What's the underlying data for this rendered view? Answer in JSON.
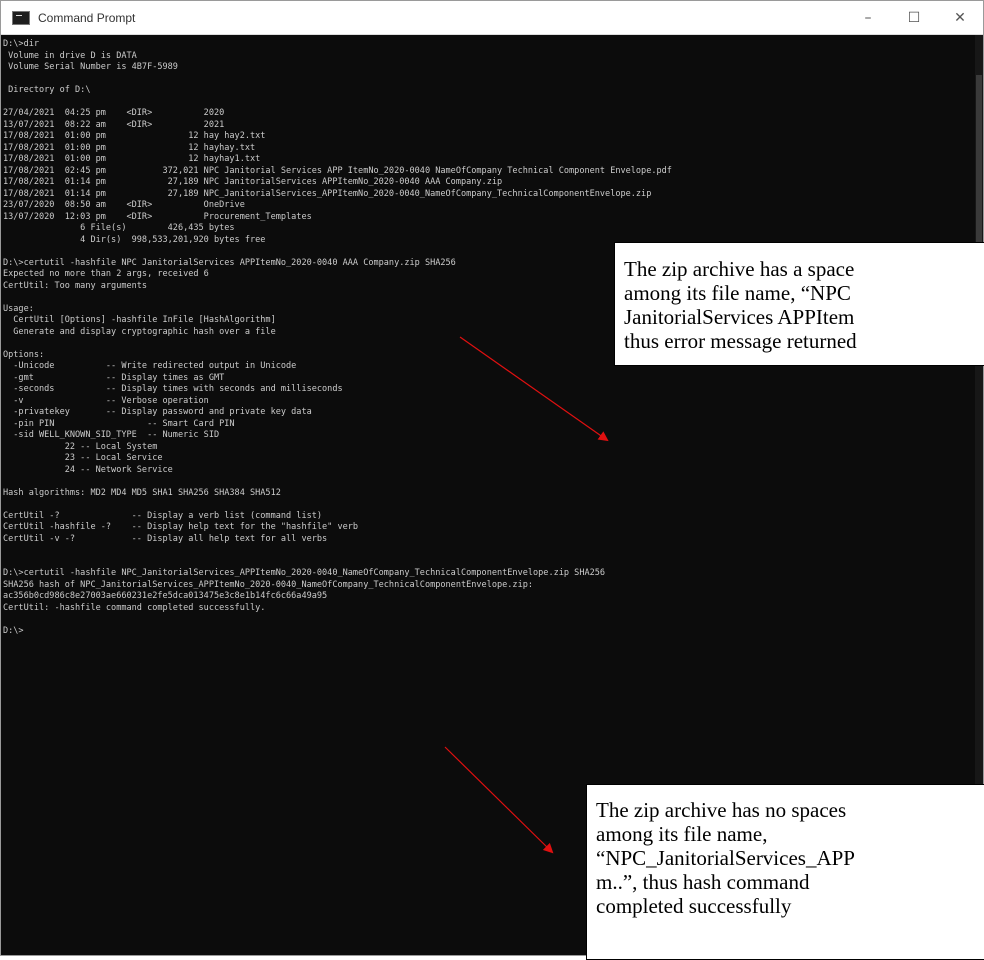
{
  "window": {
    "title": "Command Prompt",
    "controls": {
      "minimize": "–",
      "maximize": "☐",
      "close": "✕"
    }
  },
  "console_lines": [
    "D:\\>dir",
    " Volume in drive D is DATA",
    " Volume Serial Number is 4B7F-5989",
    "",
    " Directory of D:\\",
    "",
    "27/04/2021  04:25 pm    <DIR>          2020",
    "13/07/2021  08:22 am    <DIR>          2021",
    "17/08/2021  01:00 pm                12 hay hay2.txt",
    "17/08/2021  01:00 pm                12 hayhay.txt",
    "17/08/2021  01:00 pm                12 hayhay1.txt",
    "17/08/2021  02:45 pm           372,021 NPC Janitorial Services APP ItemNo_2020-0040 NameOfCompany Technical Component Envelope.pdf",
    "17/08/2021  01:14 pm            27,189 NPC JanitorialServices APPItemNo_2020-0040 AAA Company.zip",
    "17/08/2021  01:14 pm            27,189 NPC_JanitorialServices_APPItemNo_2020-0040_NameOfCompany_TechnicalComponentEnvelope.zip",
    "23/07/2020  08:50 am    <DIR>          OneDrive",
    "13/07/2020  12:03 pm    <DIR>          Procurement_Templates",
    "               6 File(s)        426,435 bytes",
    "               4 Dir(s)  998,533,201,920 bytes free",
    "",
    "D:\\>certutil -hashfile NPC JanitorialServices APPItemNo_2020-0040 AAA Company.zip SHA256",
    "Expected no more than 2 args, received 6",
    "CertUtil: Too many arguments",
    "",
    "Usage:",
    "  CertUtil [Options] -hashfile InFile [HashAlgorithm]",
    "  Generate and display cryptographic hash over a file",
    "",
    "Options:",
    "  -Unicode          -- Write redirected output in Unicode",
    "  -gmt              -- Display times as GMT",
    "  -seconds          -- Display times with seconds and milliseconds",
    "  -v                -- Verbose operation",
    "  -privatekey       -- Display password and private key data",
    "  -pin PIN                  -- Smart Card PIN",
    "  -sid WELL_KNOWN_SID_TYPE  -- Numeric SID",
    "            22 -- Local System",
    "            23 -- Local Service",
    "            24 -- Network Service",
    "",
    "Hash algorithms: MD2 MD4 MD5 SHA1 SHA256 SHA384 SHA512",
    "",
    "CertUtil -?              -- Display a verb list (command list)",
    "CertUtil -hashfile -?    -- Display help text for the \"hashfile\" verb",
    "CertUtil -v -?           -- Display all help text for all verbs",
    "",
    "",
    "D:\\>certutil -hashfile NPC_JanitorialServices_APPItemNo_2020-0040_NameOfCompany_TechnicalComponentEnvelope.zip SHA256",
    "SHA256 hash of NPC_JanitorialServices_APPItemNo_2020-0040_NameOfCompany_TechnicalComponentEnvelope.zip:",
    "ac356b0cd986c8e27003ae660231e2fe5dca013475e3c8e1b14fc6c66a49a95",
    "CertUtil: -hashfile command completed successfully.",
    "",
    "D:\\>"
  ],
  "callouts": {
    "first": [
      "The zip archive has a space",
      "among its file name, “NPC",
      "JanitorialServices APPItem",
      "thus error message returned"
    ],
    "second": [
      "The zip archive has no spaces",
      "among its file name,",
      "“NPC_JanitorialServices_APP",
      "m..”, thus hash command",
      "completed successfully"
    ]
  },
  "colors": {
    "console_bg": "#0c0c0c",
    "console_text": "#cccccc",
    "arrow": "#e01010"
  }
}
